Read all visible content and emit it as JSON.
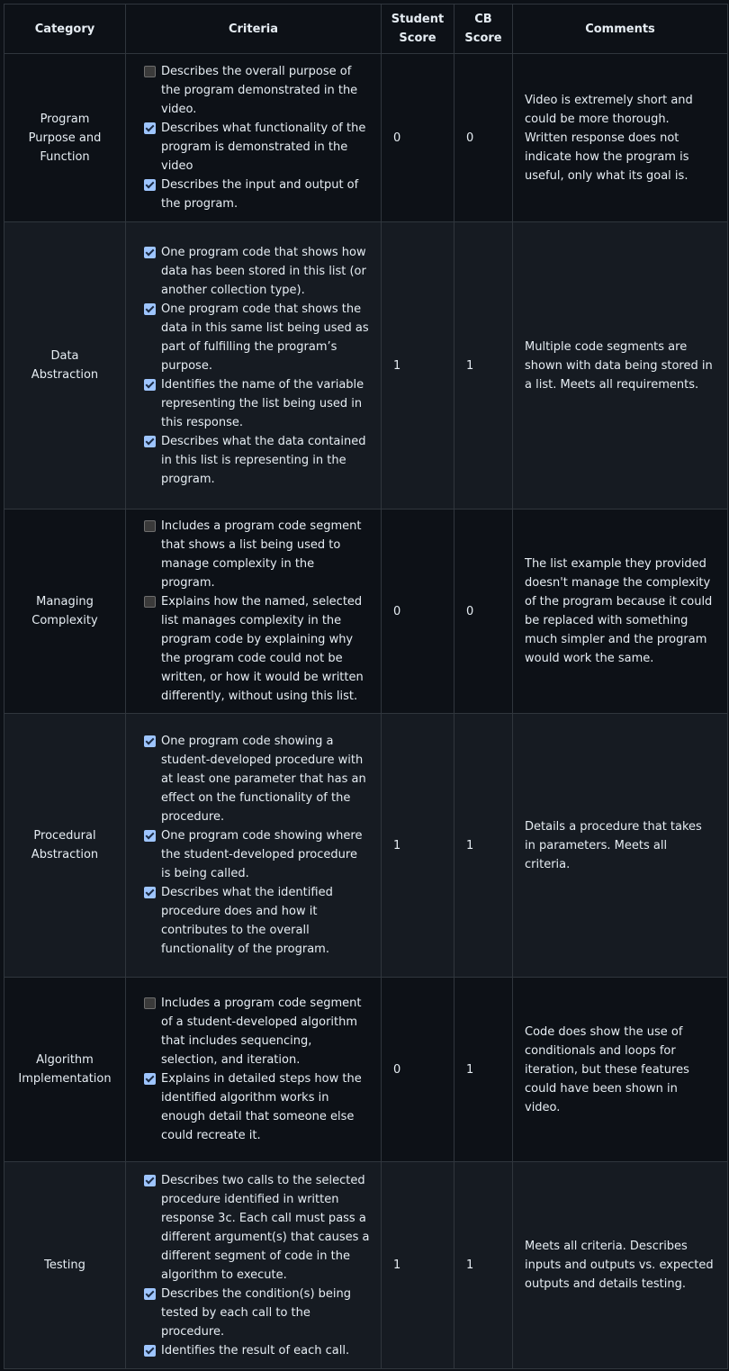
{
  "table": {
    "headers": {
      "category": "Category",
      "criteria": "Criteria",
      "student_score": "Student Score",
      "cb_score": "CB Score",
      "comments": "Comments"
    },
    "rows": [
      {
        "category": "Program Purpose and Function",
        "criteria": [
          {
            "checked": false,
            "text": "Describes the overall purpose of the program demonstrated in the video."
          },
          {
            "checked": true,
            "text": "Describes what functionality of the program is demonstrated in the video"
          },
          {
            "checked": true,
            "text": "Describes the input and output of the program."
          }
        ],
        "student_score": "0",
        "cb_score": "0",
        "comments": "Video is extremely short and could be more thorough. Written response does not indicate how the program is useful, only what its goal is."
      },
      {
        "category": "Data Abstraction",
        "criteria": [
          {
            "checked": true,
            "text": "One program code that shows how data has been stored in this list (or another collection type)."
          },
          {
            "checked": true,
            "text": "One program code that shows the data in this same list being used as part of fulfilling the program’s purpose."
          },
          {
            "checked": true,
            "text": "Identifies the name of the variable representing the list being used in this response."
          },
          {
            "checked": true,
            "text": "Describes what the data contained in this list is representing in the program."
          }
        ],
        "student_score": "1",
        "cb_score": "1",
        "comments": "Multiple code segments are shown with data being stored in a list. Meets all requirements."
      },
      {
        "category": "Managing Complexity",
        "criteria": [
          {
            "checked": false,
            "text": "Includes a program code segment that shows a list being used to manage complexity in the program."
          },
          {
            "checked": false,
            "text": "Explains how the named, selected list manages complexity in the program code by explaining why the program code could not be written, or how it would be written differently, without using this list."
          }
        ],
        "student_score": "0",
        "cb_score": "0",
        "comments": "The list example they provided doesn't manage the complexity of the program because it could be replaced with something much simpler and the program would work the same."
      },
      {
        "category": "Procedural Abstraction",
        "criteria": [
          {
            "checked": true,
            "text": "One program code showing a student-developed procedure with at least one parameter that has an effect on the functionality of the procedure."
          },
          {
            "checked": true,
            "text": "One program code showing where the student-developed procedure is being called."
          },
          {
            "checked": true,
            "text": "Describes what the identified procedure does and how it contributes to the overall functionality of the program."
          }
        ],
        "student_score": "1",
        "cb_score": "1",
        "comments": "Details a procedure that takes in parameters. Meets all criteria."
      },
      {
        "category": "Algorithm Implementation",
        "criteria": [
          {
            "checked": false,
            "text": "Includes a program code segment of a student-developed algorithm that includes sequencing, selection, and iteration."
          },
          {
            "checked": true,
            "text": "Explains in detailed steps how the identified algorithm works in enough detail that someone else could recreate it."
          }
        ],
        "student_score": "0",
        "cb_score": "1",
        "comments": "Code does show the use of conditionals and loops for iteration, but these features could have been shown in video."
      },
      {
        "category": "Testing",
        "criteria": [
          {
            "checked": true,
            "text": "Describes two calls to the selected procedure identified in written response 3c. Each call must pass a different argument(s) that causes a different segment of code in the algorithm to execute."
          },
          {
            "checked": true,
            "text": "Describes the condition(s) being tested by each call to the procedure."
          },
          {
            "checked": true,
            "text": "Identifies the result of each call."
          }
        ],
        "student_score": "1",
        "cb_score": "1",
        "comments": "Meets all criteria. Describes inputs and outputs vs. expected outputs and details testing."
      }
    ]
  }
}
